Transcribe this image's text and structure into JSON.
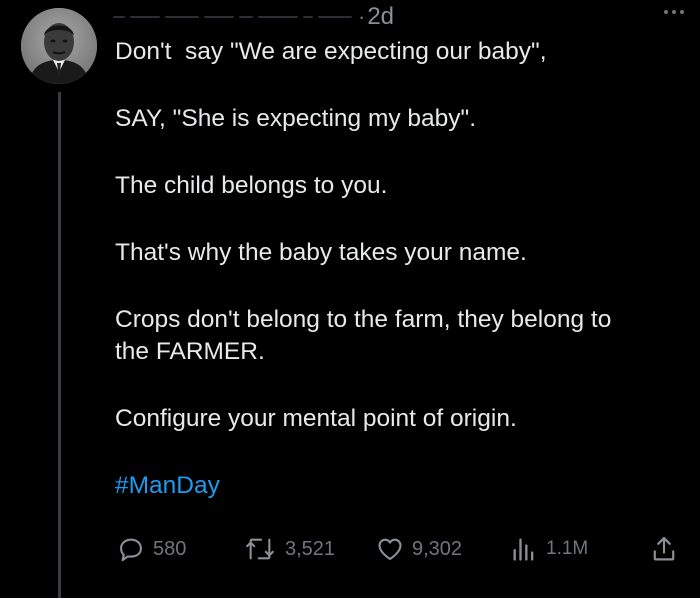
{
  "post": {
    "timestamp": "2d",
    "separator": "·",
    "lines": [
      "Don't  say \"We are expecting our baby\",",
      "SAY, \"She is expecting my baby\".",
      "The child belongs to you.",
      "That's why the baby takes your name.",
      "Crops don't belong to the farm, they belong to\nthe FARMER.",
      "Configure your mental point of origin."
    ],
    "hashtag": "#ManDay"
  },
  "actions": {
    "replies": "580",
    "reposts": "3,521",
    "likes": "9,302",
    "views": "1.1M"
  },
  "colors": {
    "background": "#000000",
    "text": "#e7e9ea",
    "muted": "#71767b",
    "link": "#1d9bf0"
  },
  "icons": [
    "avatar",
    "more-icon",
    "reply-icon",
    "repost-icon",
    "like-icon",
    "views-icon",
    "share-icon"
  ]
}
